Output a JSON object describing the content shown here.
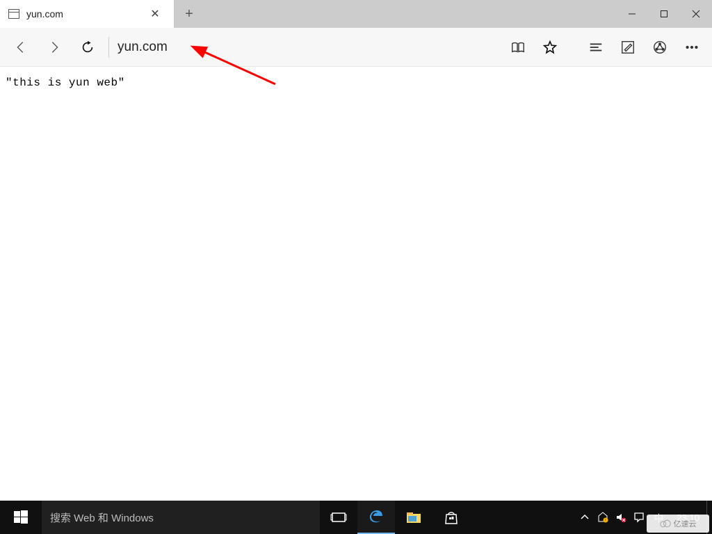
{
  "browser": {
    "tab_title": "yun.com",
    "address": "yun.com",
    "page_body": "\"this is yun web\""
  },
  "icons": {
    "back": "back",
    "forward": "forward",
    "refresh": "refresh",
    "reading": "reading-view",
    "star": "favorites",
    "hub": "hub",
    "note": "web-note",
    "share": "share",
    "more": "more"
  },
  "taskbar": {
    "search_placeholder": "搜索 Web 和 Windows",
    "clock": "23:10",
    "ime": "中"
  },
  "watermark": "亿速云"
}
